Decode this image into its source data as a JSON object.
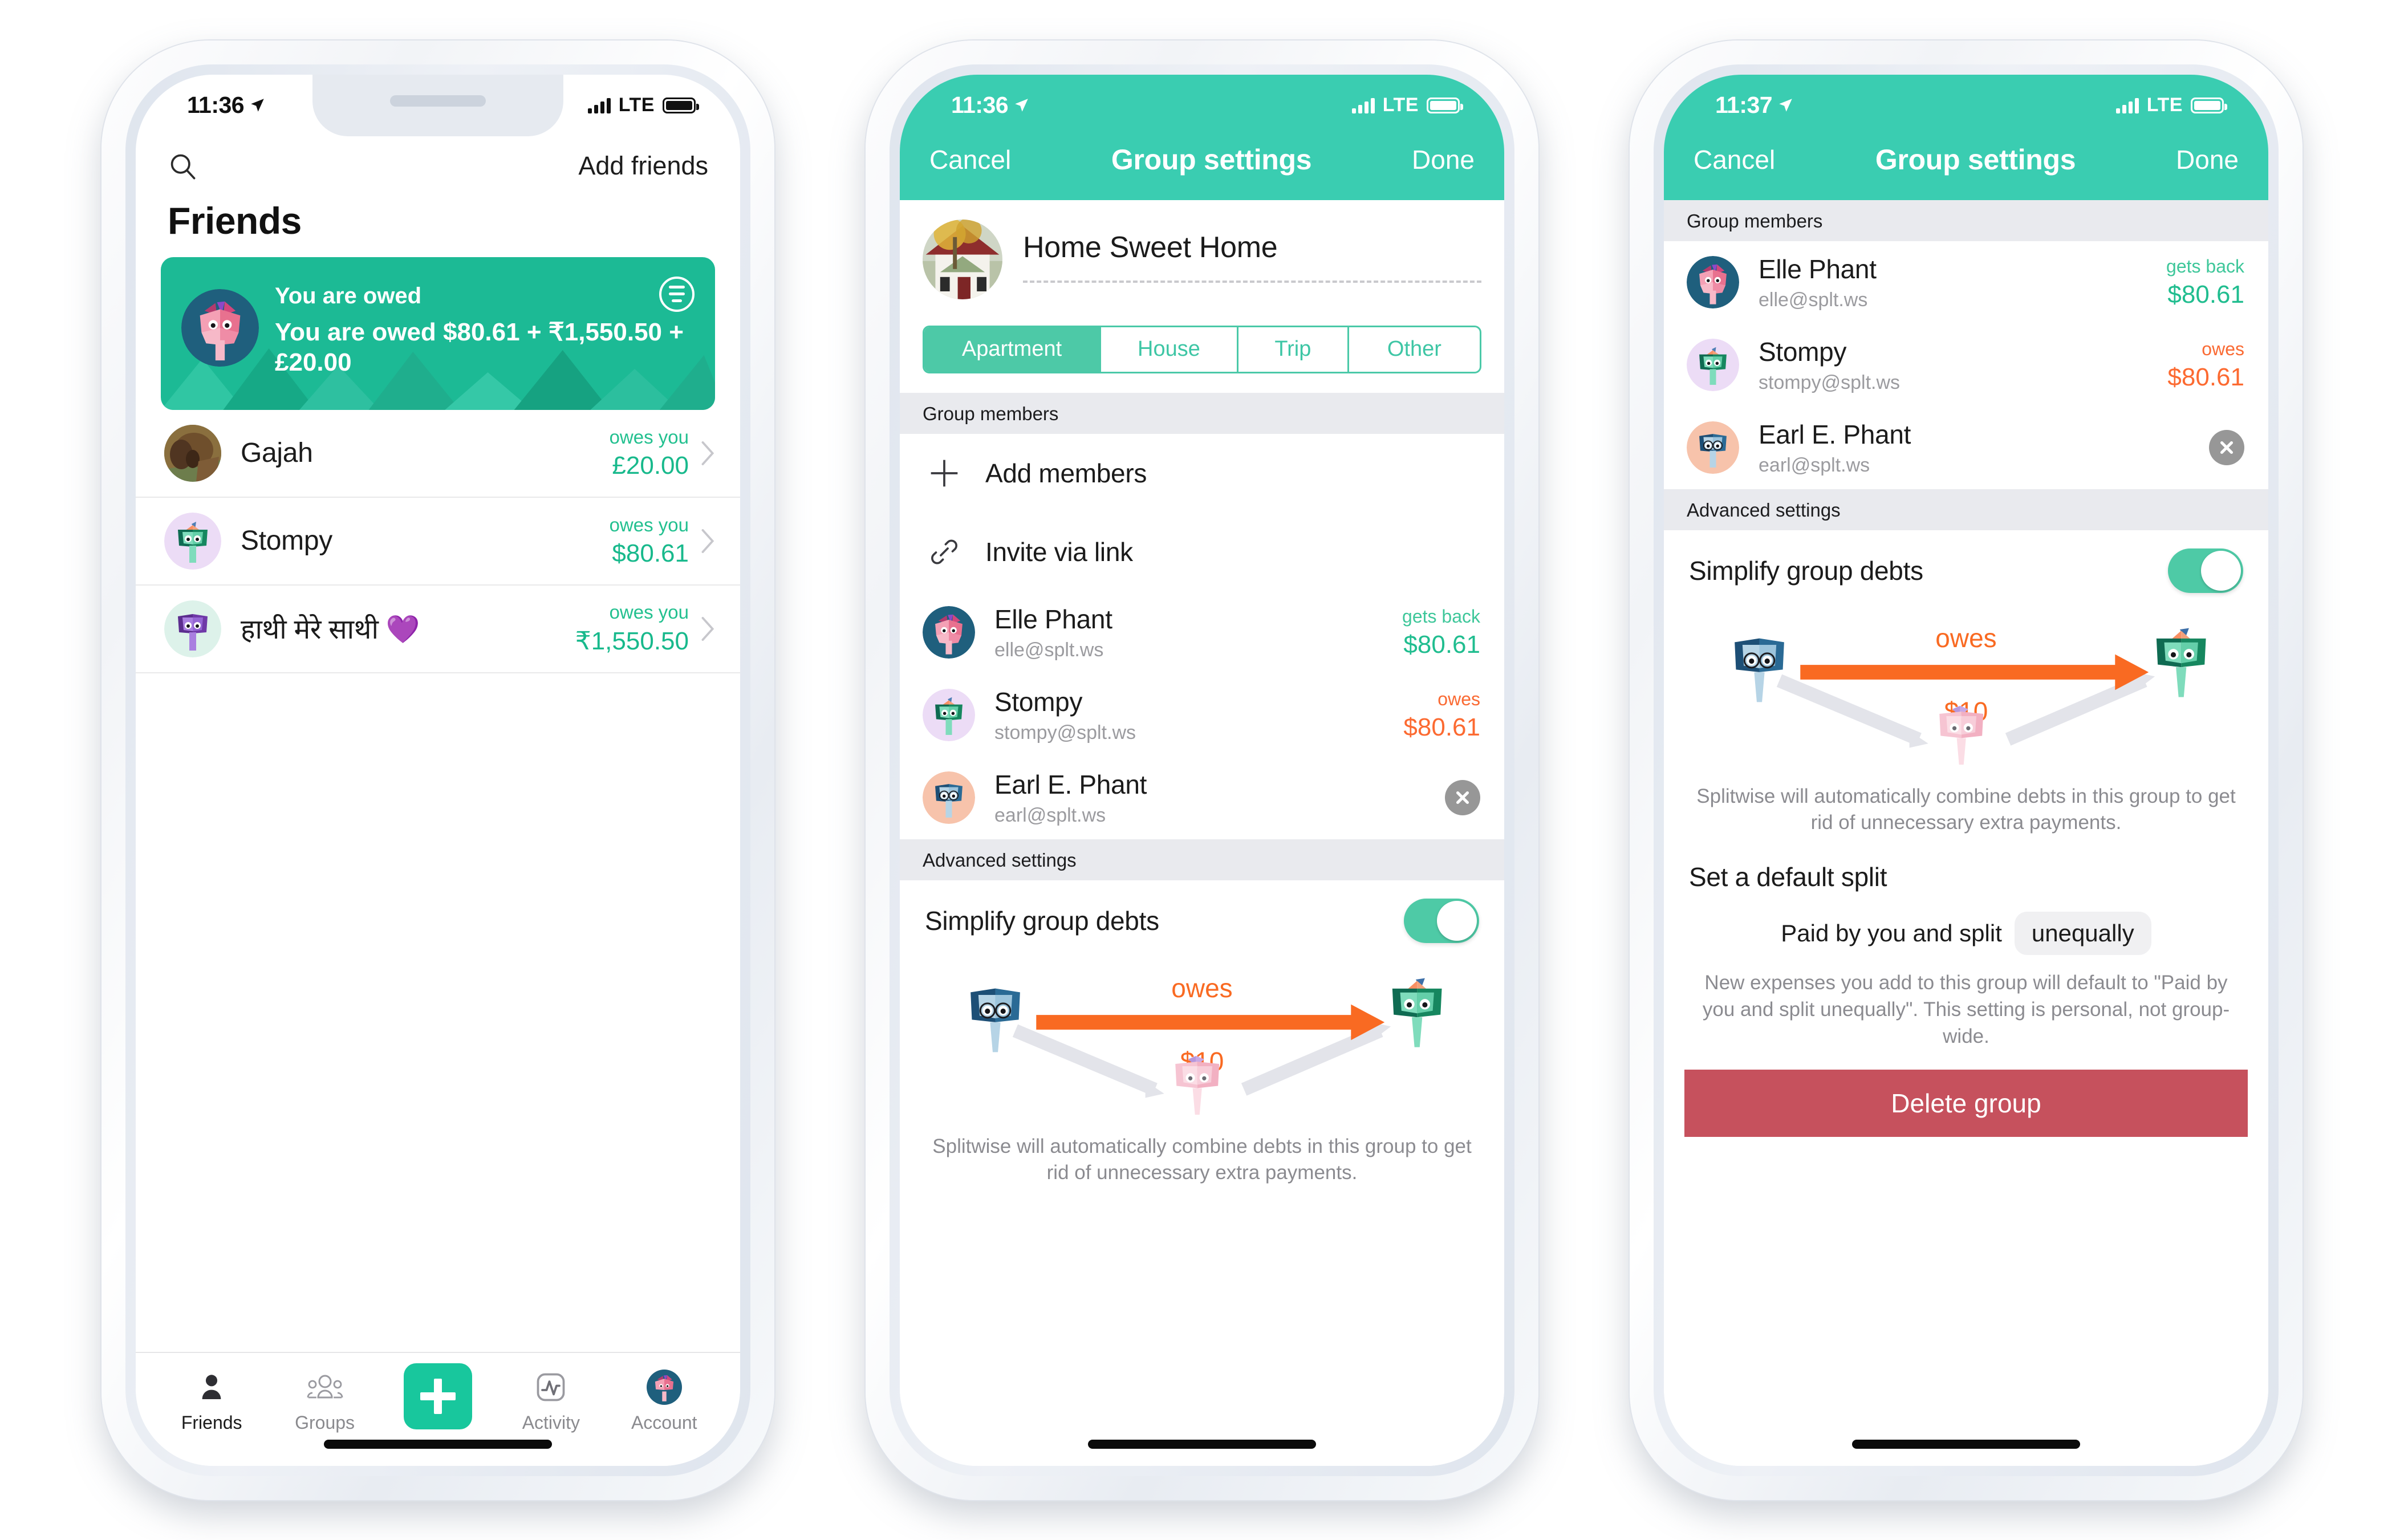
{
  "phone1": {
    "status": {
      "time": "11:36",
      "network": "LTE"
    },
    "topbar": {
      "search_icon": "search-icon",
      "add_friends": "Add friends"
    },
    "title": "Friends",
    "balance_card": {
      "heading": "You are owed",
      "detail": "You are owed $80.61 + ₹1,550.50 + £20.00",
      "menu_icon": "filter-menu-icon"
    },
    "friends": [
      {
        "name": "Gajah",
        "label": "owes you",
        "amount": "£20.00"
      },
      {
        "name": "Stompy",
        "label": "owes you",
        "amount": "$80.61"
      },
      {
        "name": "हाथी मेरे साथी 💜",
        "label": "owes you",
        "amount": "₹1,550.50"
      }
    ],
    "tabs": [
      {
        "label": "Friends",
        "icon": "person-icon",
        "active": true
      },
      {
        "label": "Groups",
        "icon": "people-group-icon",
        "active": false
      },
      {
        "label": "",
        "icon": "plus-icon",
        "active": false
      },
      {
        "label": "Activity",
        "icon": "activity-pulse-icon",
        "active": false
      },
      {
        "label": "Account",
        "icon": "account-avatar-icon",
        "active": false
      }
    ]
  },
  "phone2": {
    "status": {
      "time": "11:36",
      "network": "LTE"
    },
    "nav": {
      "cancel": "Cancel",
      "title": "Group settings",
      "done": "Done"
    },
    "group_name": "Home Sweet Home",
    "group_types": [
      {
        "label": "Apartment",
        "selected": true
      },
      {
        "label": "House",
        "selected": false
      },
      {
        "label": "Trip",
        "selected": false
      },
      {
        "label": "Other",
        "selected": false
      }
    ],
    "members_header": "Group members",
    "actions": [
      {
        "label": "Add members",
        "icon": "plus-icon"
      },
      {
        "label": "Invite via link",
        "icon": "link-chain-icon"
      }
    ],
    "members": [
      {
        "name": "Elle Phant",
        "email": "elle@splt.ws",
        "label": "gets back",
        "amount": "$80.61",
        "tone": "pos"
      },
      {
        "name": "Stompy",
        "email": "stompy@splt.ws",
        "label": "owes",
        "amount": "$80.61",
        "tone": "neg"
      },
      {
        "name": "Earl E. Phant",
        "email": "earl@splt.ws",
        "label": "",
        "amount": "",
        "tone": "remove"
      }
    ],
    "advanced_header": "Advanced settings",
    "simplify": {
      "label": "Simplify group debts",
      "toggle_on": true,
      "diagram_owes": "owes",
      "diagram_amount": "$10",
      "note": "Splitwise will automatically combine debts in this group to get rid of unnecessary extra payments."
    }
  },
  "phone3": {
    "status": {
      "time": "11:37",
      "network": "LTE"
    },
    "nav": {
      "cancel": "Cancel",
      "title": "Group settings",
      "done": "Done"
    },
    "members_header": "Group members",
    "members": [
      {
        "name": "Elle Phant",
        "email": "elle@splt.ws",
        "label": "gets back",
        "amount": "$80.61",
        "tone": "pos"
      },
      {
        "name": "Stompy",
        "email": "stompy@splt.ws",
        "label": "owes",
        "amount": "$80.61",
        "tone": "neg"
      },
      {
        "name": "Earl E. Phant",
        "email": "earl@splt.ws",
        "label": "",
        "amount": "",
        "tone": "remove"
      }
    ],
    "advanced_header": "Advanced settings",
    "simplify": {
      "label": "Simplify group debts",
      "toggle_on": true,
      "diagram_owes": "owes",
      "diagram_amount": "$10",
      "note": "Splitwise will automatically combine debts in this group to get rid of unnecessary extra payments."
    },
    "default_split": {
      "title": "Set a default split",
      "prefix": "Paid by you and split",
      "chip": "unequally",
      "note": "New expenses you add to this group will default to \"Paid by you and split unequally\". This setting is personal, not group-wide."
    },
    "delete_button": "Delete group"
  },
  "colors": {
    "brand_green": "#1cba95",
    "nav_teal": "#3acdb1",
    "positive": "#20bd8f",
    "negative": "#fc6a31",
    "danger": "#c6515d",
    "section_bg": "#e9eaee"
  }
}
